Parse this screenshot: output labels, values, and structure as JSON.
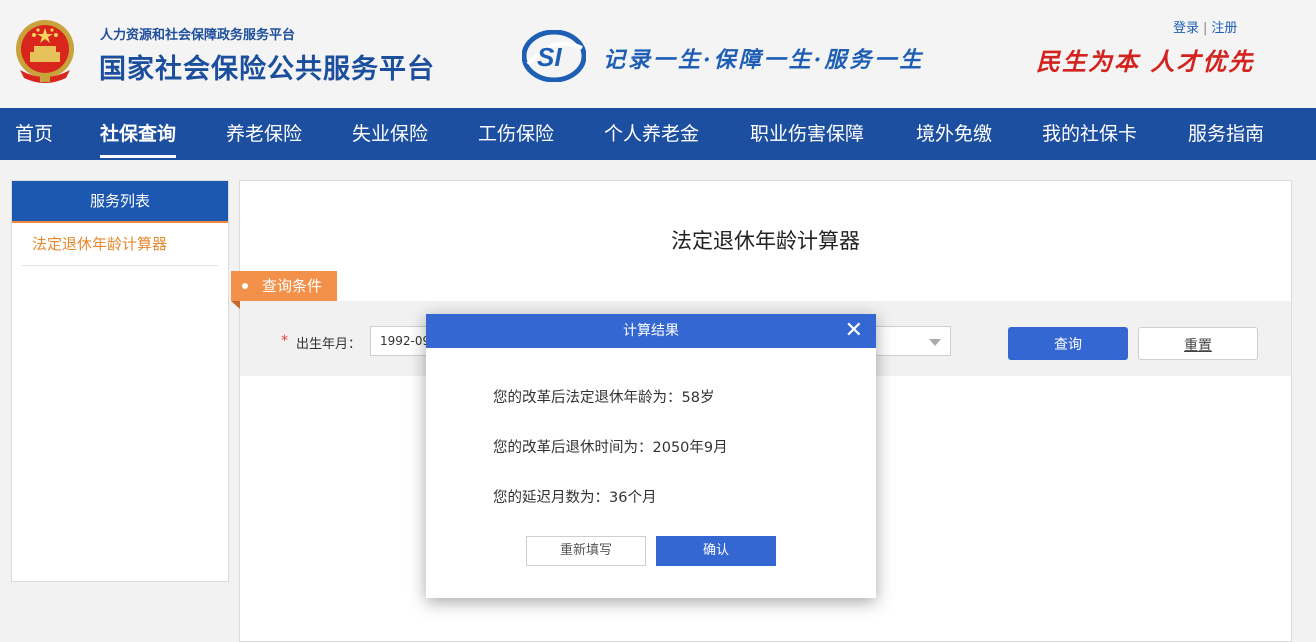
{
  "header": {
    "ministry": "人力资源和社会保障政务服务平台",
    "platform_name": "国家社会保险公共服务平台",
    "slogan": "记录一生·保障一生·服务一生",
    "motto": "民生为本 人才优先",
    "login": "登录",
    "divider": "|",
    "register": "注册",
    "emblem_icon": "national-emblem-icon",
    "logo_icon": "si-logo-icon"
  },
  "nav": {
    "items": [
      "首页",
      "社保查询",
      "养老保险",
      "失业保险",
      "工伤保险",
      "个人养老金",
      "职业伤害保障",
      "境外免缴",
      "我的社保卡",
      "服务指南"
    ],
    "active": "社保查询"
  },
  "sidebar": {
    "title": "服务列表",
    "items": [
      "法定退休年龄计算器"
    ]
  },
  "main": {
    "title": "法定退休年龄计算器",
    "section_tab": "查询条件",
    "required_mark": "*",
    "birth_label": "出生年月：",
    "birth_value": "1992-09",
    "query_button": "查询",
    "reset_button": "重置"
  },
  "modal": {
    "title": "计算结果",
    "close_icon": "close-icon",
    "close_glyph": "✕",
    "results": [
      "您的改革后法定退休年龄为：58岁",
      "您的改革后退休时间为：2050年9月",
      "您的延迟月数为：36个月"
    ],
    "refill_button": "重新填写",
    "confirm_button": "确认"
  },
  "colors": {
    "brand_blue": "#1c4fa0",
    "button_blue": "#3467d1",
    "accent_orange": "#f3914a",
    "motto_red": "#d2231f"
  }
}
